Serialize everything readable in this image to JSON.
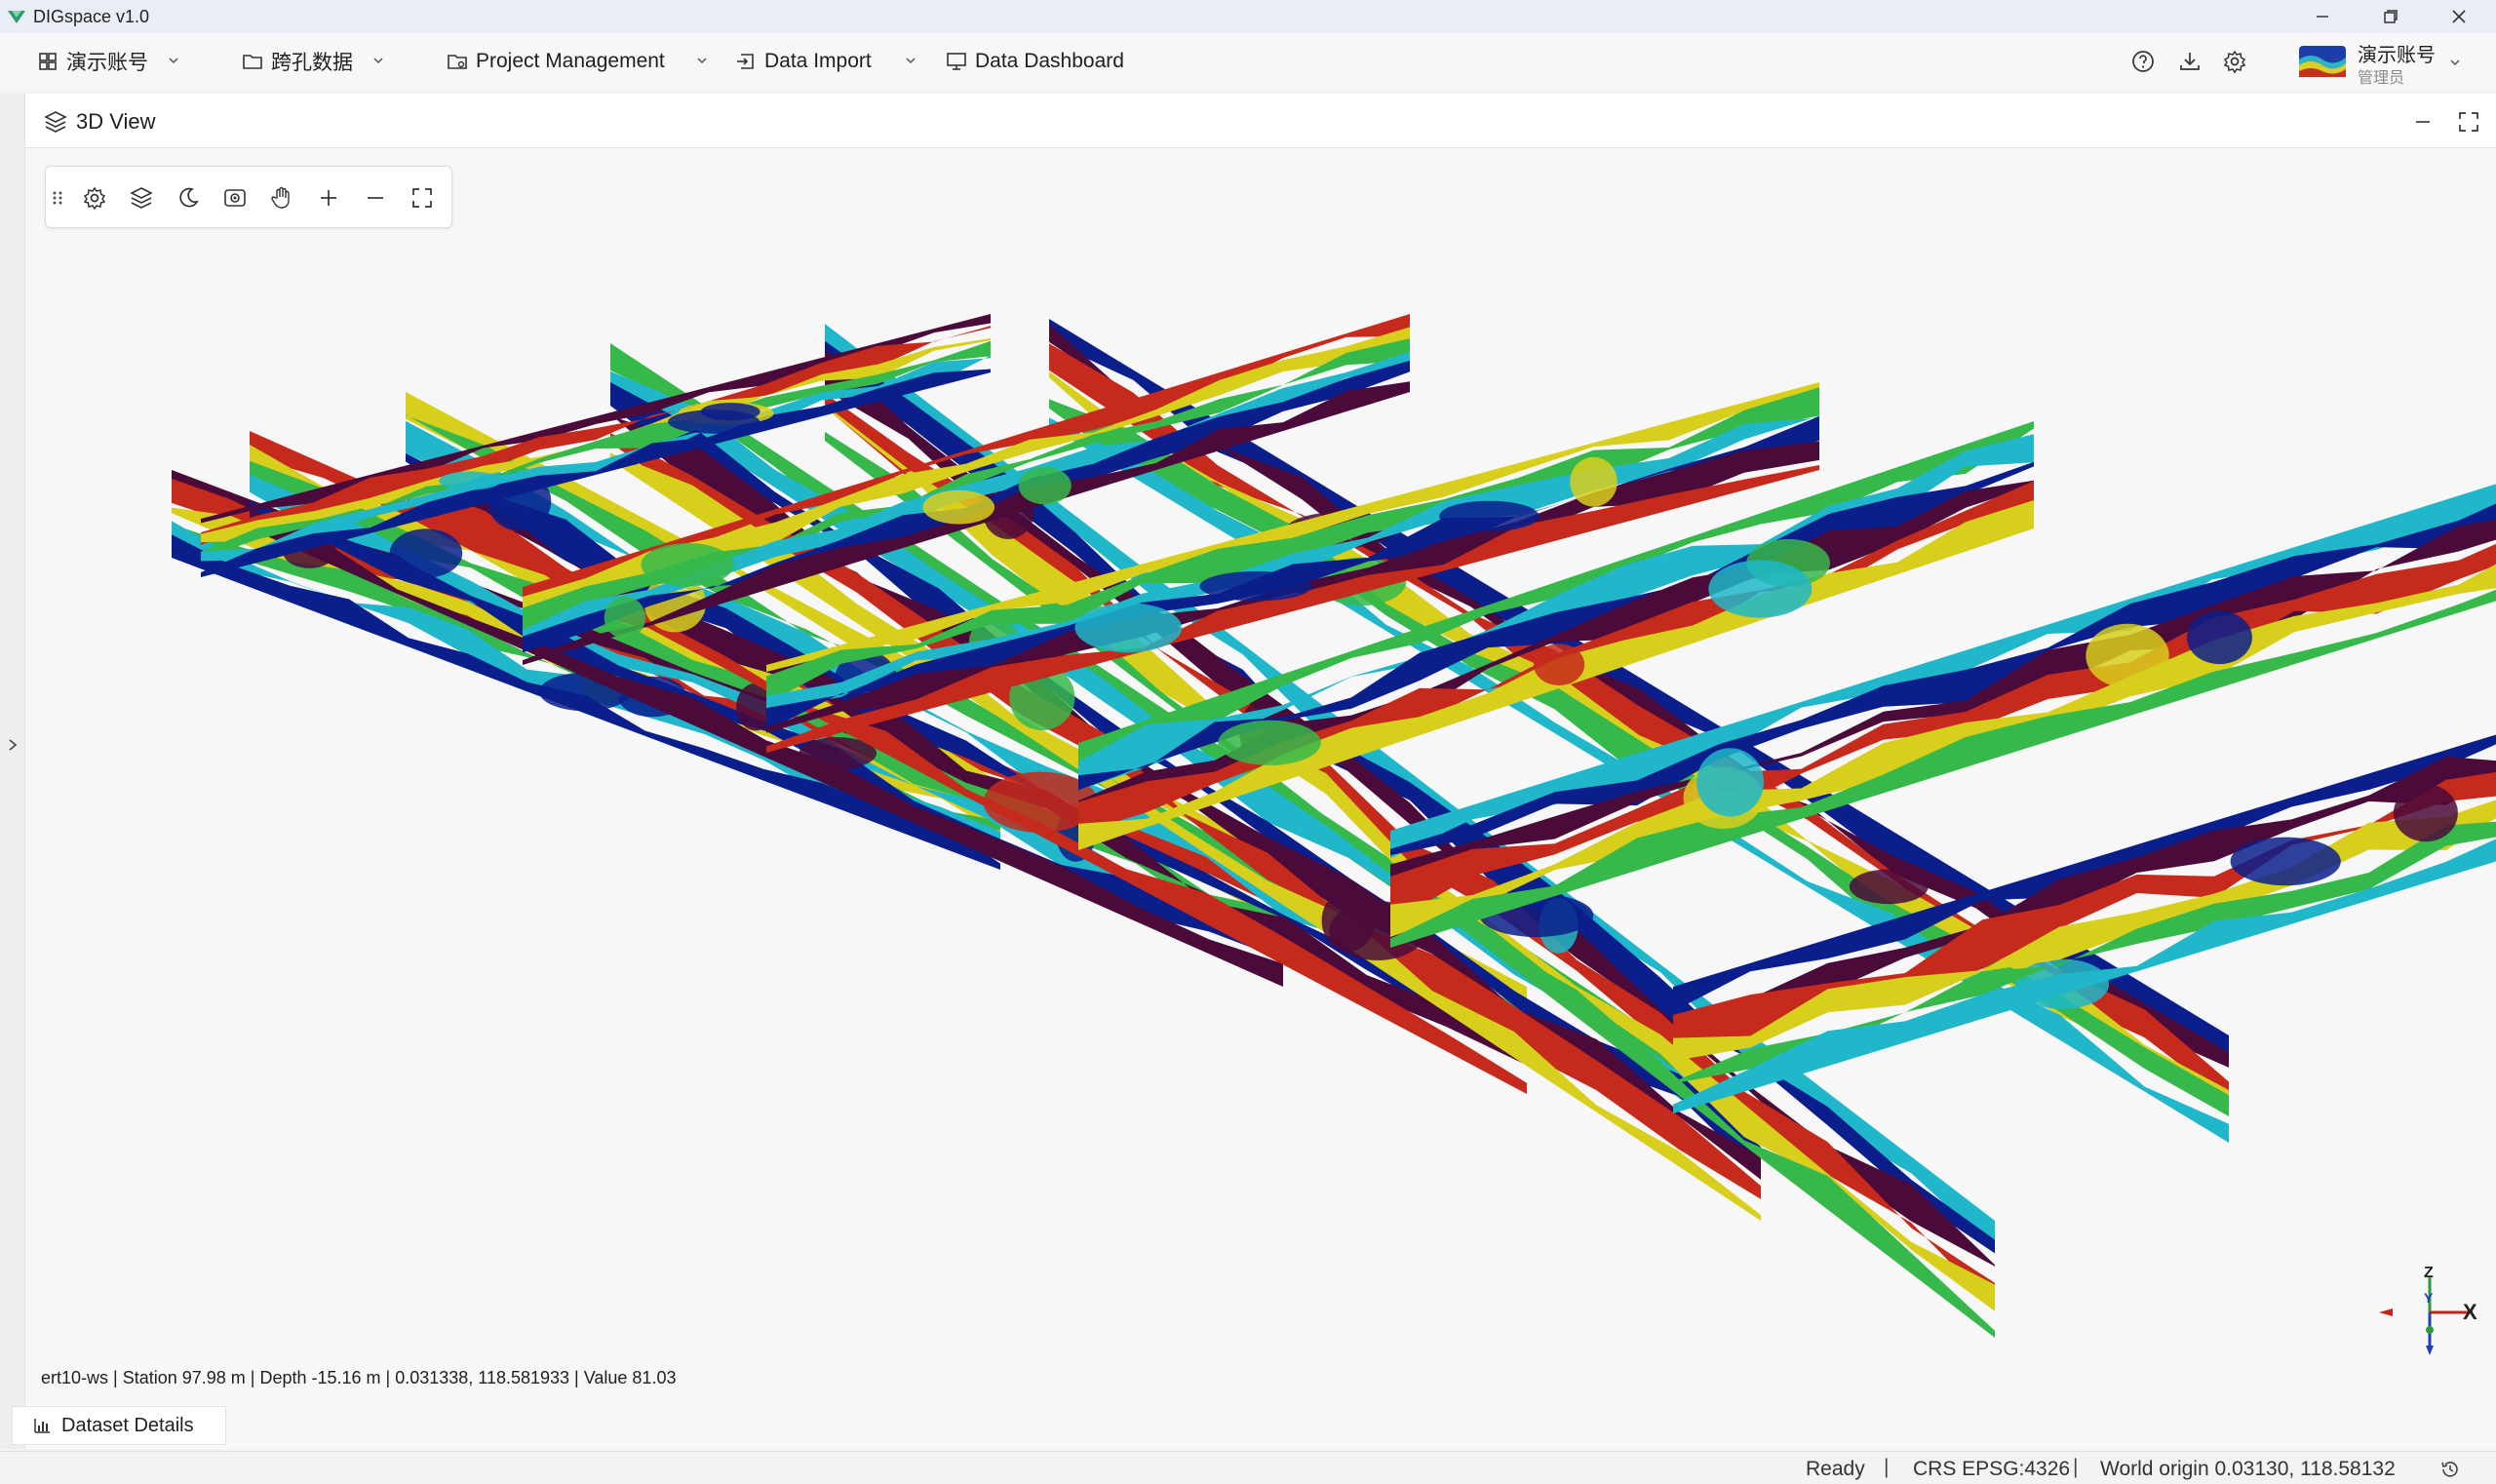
{
  "window": {
    "title": "DIGspace v1.0"
  },
  "menu": {
    "items": [
      {
        "label": "演示账号",
        "icon": "grid-icon"
      },
      {
        "label": "跨孔数据",
        "icon": "folder-icon"
      },
      {
        "label": "Project Management",
        "icon": "folder-settings-icon"
      },
      {
        "label": "Data Import",
        "icon": "import-icon"
      },
      {
        "label": "Data Dashboard",
        "icon": "monitor-icon"
      }
    ]
  },
  "user": {
    "name": "演示账号",
    "role": "管理员"
  },
  "panel": {
    "title": "3D View"
  },
  "toolbar": {
    "icons": [
      "drag-handle-icon",
      "gear-icon",
      "layers-icon",
      "moon-icon",
      "camera-icon",
      "hand-pan-icon",
      "zoom-in-icon",
      "zoom-out-icon",
      "fullscreen-icon"
    ]
  },
  "axis": {
    "z": "Z",
    "y": "Y",
    "x": "X"
  },
  "readout": {
    "text": "ert10-ws | Station 97.98 m | Depth -15.16 m | 0.031338, 118.581933 | Value 81.03"
  },
  "dataset_tab": {
    "label": "Dataset Details"
  },
  "status": {
    "ready": "Ready",
    "crs": "CRS EPSG:4326",
    "origin": "World origin  0.03130, 118.58132"
  },
  "colors": {
    "low": "#0a1e8c",
    "mid_low": "#1fb7c9",
    "mid": "#37b84a",
    "mid_high": "#d8cf1c",
    "high": "#c62a1c",
    "very_high": "#4a0b3b"
  }
}
